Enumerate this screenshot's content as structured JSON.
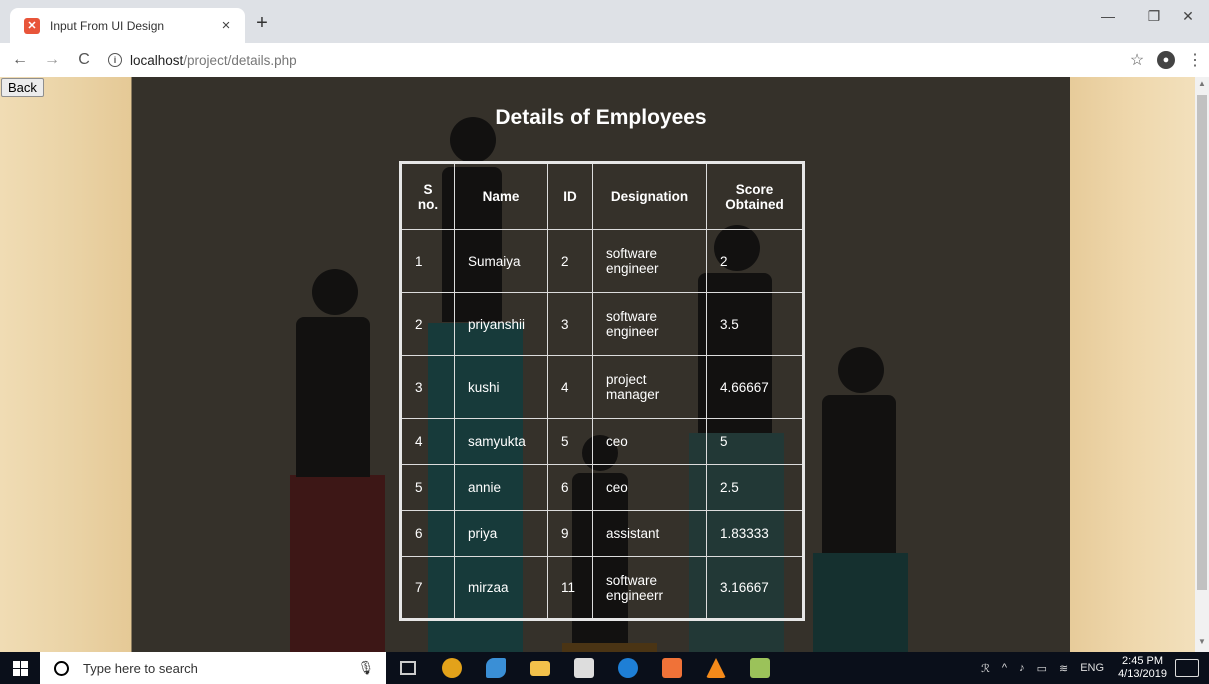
{
  "browser": {
    "tab_title": "Input From UI Design",
    "tab_close": "×",
    "new_tab": "+",
    "url_host": "localhost",
    "url_path": "/project/details.php",
    "minimize": "—",
    "maximize": "❐",
    "close": "✕",
    "back": "←",
    "forward": "→",
    "reload": "C",
    "bookmark": "☆",
    "menu": "⋮"
  },
  "page": {
    "back_button": "Back",
    "title": "Details of Employees",
    "table": {
      "headers": [
        "S no.",
        "Name",
        "ID",
        "Designation",
        "Score Obtained"
      ],
      "rows": [
        [
          "1",
          "Sumaiya",
          "2",
          "software engineer",
          "2"
        ],
        [
          "2",
          "priyanshii",
          "3",
          "software engineer",
          "3.5"
        ],
        [
          "3",
          "kushi",
          "4",
          "project manager",
          "4.66667"
        ],
        [
          "4",
          "samyukta",
          "5",
          "ceo",
          "5"
        ],
        [
          "5",
          "annie",
          "6",
          "ceo",
          "2.5"
        ],
        [
          "6",
          "priya",
          "9",
          "assistant",
          "1.83333"
        ],
        [
          "7",
          "mirzaa",
          "11",
          "software engineerr",
          "3.16667"
        ]
      ]
    }
  },
  "taskbar": {
    "search_placeholder": "Type here to search",
    "language": "ENG",
    "time": "2:45 PM",
    "date": "4/13/2019"
  }
}
